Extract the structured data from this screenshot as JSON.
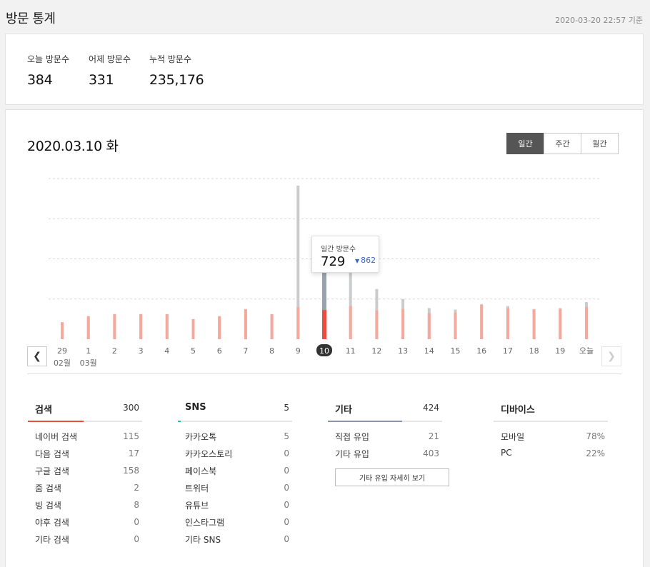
{
  "header": {
    "title": "방문 통계",
    "timestamp": "2020-03-20 22:57 기준"
  },
  "summary": {
    "today": {
      "label": "오늘 방문수",
      "value": "384"
    },
    "yesterday": {
      "label": "어제 방문수",
      "value": "331"
    },
    "total": {
      "label": "누적 방문수",
      "value": "235,176"
    }
  },
  "main": {
    "date_title": "2020.03.10 화",
    "tabs": [
      {
        "label": "일간",
        "active": true
      },
      {
        "label": "주간",
        "active": false
      },
      {
        "label": "월간",
        "active": false
      }
    ]
  },
  "tooltip": {
    "label": "일간 방문수",
    "value": "729",
    "prev_value": "862",
    "prev_icon": "down-triangle-icon"
  },
  "colors": {
    "bar_selected_top": "#9aa3ad",
    "bar_selected_bottom": "#e84d3d",
    "bar_top": "#c9cbcd",
    "bar_bottom": "#f4a99d",
    "search_accent": "#e84d3d",
    "sns_accent": "#2bbfa0",
    "etc_accent": "#8a96a8",
    "selected_label_bg": "#333333"
  },
  "chart_data": {
    "type": "bar",
    "categories": [
      "29",
      "1",
      "2",
      "3",
      "4",
      "5",
      "6",
      "7",
      "8",
      "9",
      "10",
      "11",
      "12",
      "13",
      "14",
      "15",
      "16",
      "17",
      "18",
      "19",
      "오늘"
    ],
    "sub_labels": {
      "0": "02월",
      "1": "03월"
    },
    "selected_index": 10,
    "series": [
      {
        "values": [
          0.3,
          0.41,
          0.47,
          0.48,
          0.48,
          0.37,
          0.43,
          0.56,
          0.46,
          3.06,
          1.5,
          1.7,
          1.0,
          0.8,
          0.62,
          0.59,
          0.7,
          0.66,
          0.6,
          0.62,
          0.74
        ]
      },
      {
        "values": [
          0.34,
          0.46,
          0.5,
          0.5,
          0.5,
          0.4,
          0.46,
          0.6,
          0.5,
          0.64,
          0.58,
          0.66,
          0.57,
          0.6,
          0.52,
          0.53,
          0.68,
          0.62,
          0.59,
          0.6,
          0.64
        ]
      }
    ],
    "ylim": [
      0,
      3.3
    ],
    "grid": true
  },
  "stats": {
    "search": {
      "title": "검색",
      "total": "300",
      "rows": [
        {
          "label": "네이버 검색",
          "value": "115"
        },
        {
          "label": "다음 검색",
          "value": "17"
        },
        {
          "label": "구글 검색",
          "value": "158"
        },
        {
          "label": "줌 검색",
          "value": "2"
        },
        {
          "label": "빙 검색",
          "value": "8"
        },
        {
          "label": "야후 검색",
          "value": "0"
        },
        {
          "label": "기타 검색",
          "value": "0"
        }
      ]
    },
    "sns": {
      "title": "SNS",
      "total": "5",
      "rows": [
        {
          "label": "카카오톡",
          "value": "5"
        },
        {
          "label": "카카오스토리",
          "value": "0"
        },
        {
          "label": "페이스북",
          "value": "0"
        },
        {
          "label": "트위터",
          "value": "0"
        },
        {
          "label": "유튜브",
          "value": "0"
        },
        {
          "label": "인스타그램",
          "value": "0"
        },
        {
          "label": "기타 SNS",
          "value": "0"
        }
      ]
    },
    "etc": {
      "title": "기타",
      "total": "424",
      "rows": [
        {
          "label": "직접 유입",
          "value": "21"
        },
        {
          "label": "기타 유입",
          "value": "403"
        }
      ],
      "detail_button": "기타 유입 자세히 보기"
    },
    "device": {
      "title": "디바이스",
      "rows": [
        {
          "label": "모바일",
          "value": "78%"
        },
        {
          "label": "PC",
          "value": "22%"
        }
      ]
    }
  },
  "nav": {
    "prev_icon": "chevron-left-icon",
    "next_icon": "chevron-right-icon"
  }
}
